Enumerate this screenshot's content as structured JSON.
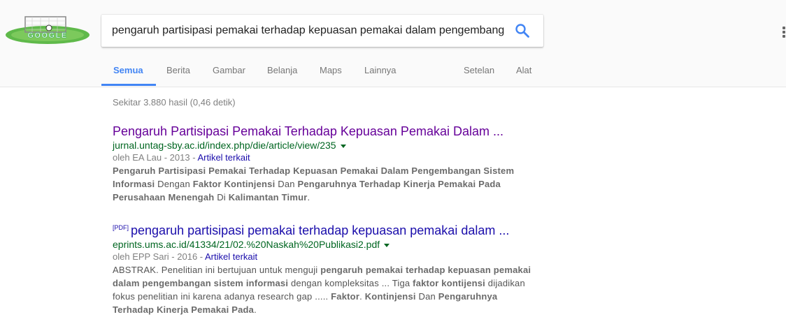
{
  "header": {
    "logo_text": "GOOGLE",
    "search": {
      "query": "pengaruh partisipasi pemakai terhadap kepuasan pemakai dalam pengembang"
    }
  },
  "tabs": [
    {
      "label": "Semua",
      "active": true
    },
    {
      "label": "Berita"
    },
    {
      "label": "Gambar"
    },
    {
      "label": "Belanja"
    },
    {
      "label": "Maps"
    },
    {
      "label": "Lainnya"
    },
    {
      "label": "Setelan"
    },
    {
      "label": "Alat"
    }
  ],
  "stats": "Sekitar 3.880 hasil (0,46 detik)",
  "results": [
    {
      "title": "Pengaruh Partisipasi Pemakai Terhadap Kepuasan Pemakai Dalam ...",
      "url": "jurnal.untag-sby.ac.id/index.php/die/article/view/235",
      "meta_prefix": "oleh EA Lau - 2013 - ",
      "related_label": "Artikel terkait",
      "snippet": [
        {
          "t": "Pengaruh Partisipasi Pemakai Terhadap Kepuasan Pemakai Dalam Pengembangan Sistem Informasi",
          "b": true
        },
        {
          "t": " Dengan ",
          "b": false
        },
        {
          "t": "Faktor Kontinjensi",
          "b": true
        },
        {
          "t": " Dan ",
          "b": false
        },
        {
          "t": "Pengaruhnya Terhadap Kinerja Pemakai Pada Perusahaan Menengah",
          "b": true
        },
        {
          "t": " Di ",
          "b": false
        },
        {
          "t": "Kalimantan Timur",
          "b": true
        },
        {
          "t": ".",
          "b": false
        }
      ]
    },
    {
      "pdf_tag": "[PDF]",
      "title": "pengaruh partisipasi pemakai terhadap kepuasan pemakai dalam ...",
      "url": "eprints.ums.ac.id/41334/21/02.%20Naskah%20Publikasi2.pdf",
      "meta_prefix": "oleh EPP Sari - 2016 - ",
      "related_label": "Artikel terkait",
      "snippet": [
        {
          "t": "ABSTRAK. Penelitian ini bertujuan untuk menguji ",
          "b": false
        },
        {
          "t": "pengaruh pemakai terhadap kepuasan pemakai dalam pengembangan sistem informasi",
          "b": true
        },
        {
          "t": " dengan kompleksitas ... Tiga ",
          "b": false
        },
        {
          "t": "faktor kontijensi",
          "b": true
        },
        {
          "t": " dijadikan fokus penelitian ini karena adanya research gap ..... ",
          "b": false
        },
        {
          "t": "Faktor",
          "b": true
        },
        {
          "t": ". ",
          "b": false
        },
        {
          "t": "Kontinjensi",
          "b": true
        },
        {
          "t": " Dan ",
          "b": false
        },
        {
          "t": "Pengaruhnya Terhadap Kinerja Pemakai Pada",
          "b": true
        },
        {
          "t": ".",
          "b": false
        }
      ]
    }
  ]
}
